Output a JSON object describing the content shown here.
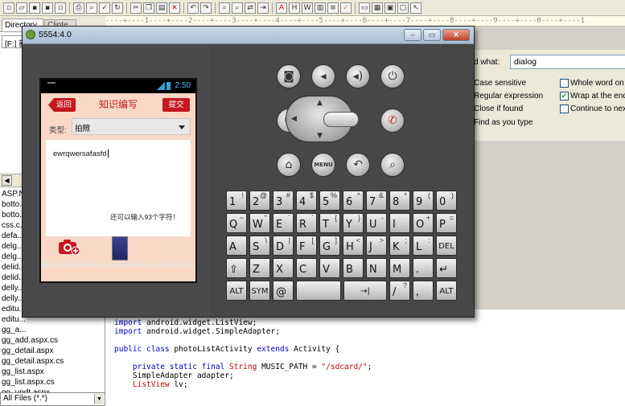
{
  "editor": {
    "ruler": "----+----1----+----2----+----3----+----4----+----5----+----6----+----7----+----8----+----9----+----0----+----1",
    "code_lines": [
      {
        "parts": [
          [
            "kw",
            "import"
          ],
          [
            "txt",
            " android.widget.ListView;"
          ]
        ]
      },
      {
        "parts": [
          [
            "kw",
            "import"
          ],
          [
            "txt",
            " android.widget.SimpleAdapter;"
          ]
        ]
      },
      {
        "parts": [
          [
            "txt",
            ""
          ]
        ]
      },
      {
        "parts": [
          [
            "kw",
            "public class"
          ],
          [
            "txt",
            " photoListActivity "
          ],
          [
            "kw",
            "extends"
          ],
          [
            "txt",
            " Activity {"
          ]
        ]
      },
      {
        "parts": [
          [
            "txt",
            ""
          ]
        ]
      },
      {
        "parts": [
          [
            "txt",
            "    "
          ],
          [
            "kw",
            "private static final"
          ],
          [
            "txt",
            " "
          ],
          [
            "ty",
            "String"
          ],
          [
            "txt",
            " MUSIC_PATH = "
          ],
          [
            "str",
            "\"/sdcard/\""
          ],
          [
            "txt",
            ";"
          ]
        ]
      },
      {
        "parts": [
          [
            "txt",
            "    SimpleAdapter adapter;"
          ]
        ]
      },
      {
        "parts": [
          [
            "txt",
            "    "
          ],
          [
            "ty",
            "ListView"
          ],
          [
            "txt",
            " lv;"
          ]
        ]
      }
    ]
  },
  "left_panel": {
    "tab1": "Directory",
    "tab2": "Clipte...",
    "drive": "[F:] 新",
    "files": [
      "ASP.N...",
      "botto...",
      "botto...",
      "css.c...",
      "defa...",
      "delg...",
      "delg...",
      "delid...",
      "delid...",
      "delly...",
      "delly...",
      "editu...",
      "editu...",
      "gg_a...",
      "gg_add.aspx.cs",
      "gg_detail.aspx",
      "gg_detail.aspx.cs",
      "gg_list.aspx",
      "gg_list.aspx.cs",
      "gg_updt.aspx"
    ],
    "filter": "All Files (*.*)"
  },
  "find_dialog": {
    "find_what_label": "d what:",
    "find_what_value": "dialog",
    "opt_case": "Case sensitive",
    "opt_regex": "Regular expression",
    "opt_close": "Close if found",
    "opt_type": "Find as you type",
    "opt_whole": "Whole word on",
    "opt_wrap": "Wrap at the end",
    "opt_continue": "Continue to nex"
  },
  "emulator": {
    "title": "5554:4.0",
    "status_time": "2:50",
    "back_label": "返回",
    "app_title": "知识编写",
    "submit_label": "提交",
    "type_label": "类型:",
    "type_value": "拍照",
    "content_text": "ewrqwersafasfd",
    "remaining_text": "还可以输入93个字符！"
  },
  "keyboard": {
    "rows": [
      [
        [
          "1",
          "!"
        ],
        [
          "2",
          "@"
        ],
        [
          "3",
          "#"
        ],
        [
          "4",
          "$"
        ],
        [
          "5",
          "%"
        ],
        [
          "6",
          "^"
        ],
        [
          "7",
          "&"
        ],
        [
          "8",
          "*"
        ],
        [
          "9",
          "("
        ],
        [
          "0",
          ")"
        ]
      ],
      [
        [
          "Q",
          "~"
        ],
        [
          "W",
          "\""
        ],
        [
          "E",
          "´"
        ],
        [
          "R",
          "`"
        ],
        [
          "T",
          "{"
        ],
        [
          "Y",
          "}"
        ],
        [
          "U",
          "-"
        ],
        [
          "I",
          ""
        ],
        [
          "O",
          "+"
        ],
        [
          "P",
          "="
        ]
      ],
      [
        [
          "A",
          ""
        ],
        [
          "S",
          "\\"
        ],
        [
          "D",
          "|"
        ],
        [
          "F",
          "["
        ],
        [
          "G",
          "]"
        ],
        [
          "H",
          "<"
        ],
        [
          "J",
          ">"
        ],
        [
          "K",
          ";"
        ],
        [
          "L",
          ":"
        ],
        [
          "DEL",
          ""
        ]
      ],
      [
        [
          "⇧",
          ""
        ],
        [
          "Z",
          ""
        ],
        [
          "X",
          ""
        ],
        [
          "C",
          ""
        ],
        [
          "V",
          ""
        ],
        [
          "B",
          ""
        ],
        [
          "N",
          ""
        ],
        [
          "M",
          ""
        ],
        [
          ".",
          ""
        ],
        [
          "↵",
          ""
        ]
      ],
      [
        [
          "ALT",
          ""
        ],
        [
          "SYM",
          ""
        ],
        [
          "@",
          ""
        ],
        [
          "",
          ""
        ],
        [
          "→|",
          ""
        ],
        [
          "/",
          "?"
        ],
        [
          ",",
          ""
        ],
        [
          "ALT",
          ""
        ]
      ]
    ],
    "menu_label": "MENU"
  },
  "colors": {
    "accent_red": "#c5171f",
    "phone_bg": "#f9d8c6",
    "status_blue": "#4fb4ee"
  }
}
